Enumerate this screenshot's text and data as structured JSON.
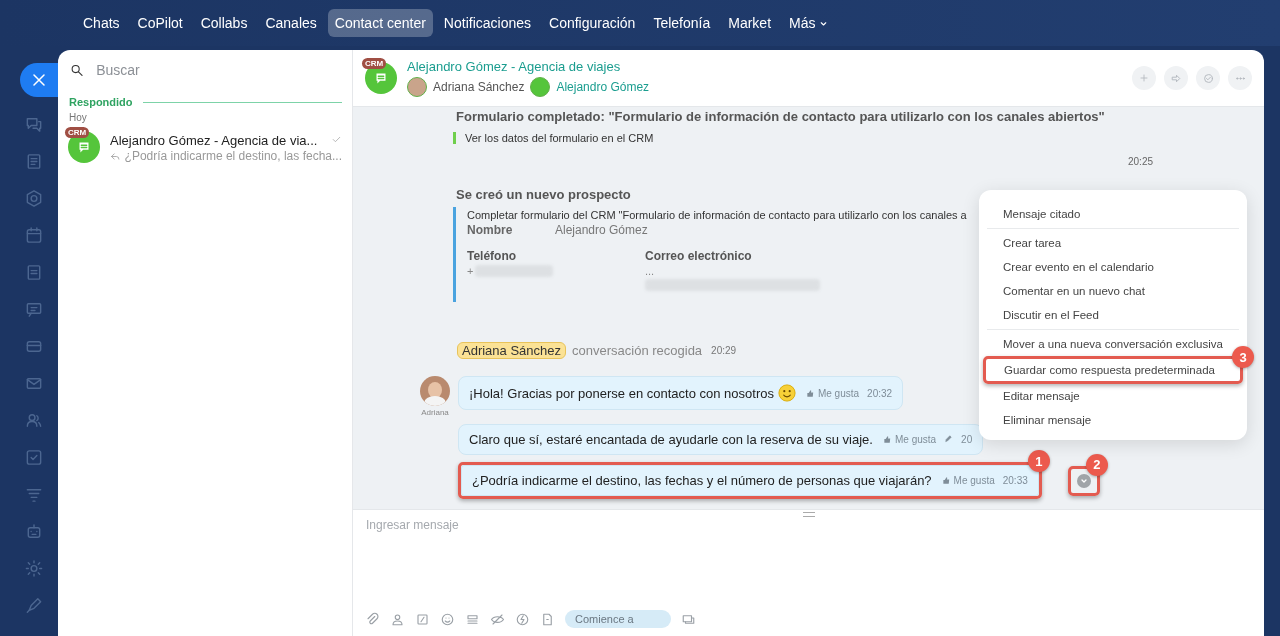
{
  "top_nav": {
    "items": [
      {
        "label": "Chats",
        "selected": false
      },
      {
        "label": "CoPilot",
        "selected": false
      },
      {
        "label": "Collabs",
        "selected": false
      },
      {
        "label": "Canales",
        "selected": false
      },
      {
        "label": "Contact center",
        "selected": true
      },
      {
        "label": "Notificaciones",
        "selected": false
      },
      {
        "label": "Configuración",
        "selected": false
      },
      {
        "label": "Telefonía",
        "selected": false
      },
      {
        "label": "Market",
        "selected": false
      },
      {
        "label": "Más",
        "selected": false,
        "kind": "dropdown"
      }
    ]
  },
  "chat_list": {
    "search": {
      "placeholder": "Buscar"
    },
    "section": "Respondido",
    "date": "Hoy",
    "items": [
      {
        "badge": "CRM",
        "title": "Alejandro Gómez - Agencia de via...",
        "preview": "¿Podría indicarme el destino, las fecha...",
        "read": true
      }
    ]
  },
  "chat": {
    "header": {
      "badge": "CRM",
      "title": "Alejandro Gómez - Agencia de viajes",
      "members": [
        {
          "name": "Adriana Sánchez",
          "kind": "agent"
        },
        {
          "name": "Alejandro Gómez",
          "kind": "client"
        }
      ]
    },
    "timeline": [
      {
        "kind": "form",
        "title": "Formulario completado: \"Formulario de información de contacto para utilizarlo con los canales abiertos\"",
        "link": "Ver los datos del formulario en el CRM",
        "time": "20:25"
      },
      {
        "kind": "lead",
        "title": "Se creó un nuevo prospecto",
        "description": "Completar formulario del CRM \"Formulario de información de contacto para utilizarlo con los canales a",
        "fields": [
          {
            "label": "Nombre",
            "value": "Alejandro Gómez"
          }
        ],
        "contacts": [
          {
            "label": "Teléfono",
            "value": "+"
          },
          {
            "label": "Correo electrónico",
            "value": "..."
          }
        ]
      },
      {
        "kind": "system",
        "name": "Adriana Sánchez",
        "text": "conversación recogida",
        "time": "20:29"
      },
      {
        "kind": "message",
        "author": "Adriana",
        "text": "¡Hola! Gracias por ponerse en contacto con nosotros",
        "emoji": true,
        "like": "Me gusta",
        "time": "20:32",
        "edited": false
      },
      {
        "kind": "message",
        "text": "Claro que sí, estaré encantada de ayudarle con la reserva de su viaje.",
        "emoji": false,
        "like": "Me gusta",
        "time": "20",
        "edited": true
      },
      {
        "kind": "message",
        "text": "¿Podría indicarme el destino, las fechas y el número de personas que viajarán?",
        "emoji": false,
        "like": "Me gusta",
        "time": "20:33",
        "edited": false,
        "callout": "1",
        "menu_callout": "2"
      }
    ],
    "context_menu": {
      "sections": [
        [
          {
            "label": "Mensaje citado"
          }
        ],
        [
          {
            "label": "Crear tarea"
          },
          {
            "label": "Crear evento en el calendario"
          },
          {
            "label": "Comentar en un nuevo chat"
          },
          {
            "label": "Discutir en el Feed"
          }
        ],
        [
          {
            "label": "Mover a una nueva conversación exclusiva"
          },
          {
            "label": "Guardar como respuesta predeterminada",
            "callout": "3"
          },
          {
            "label": "Editar mensaje"
          },
          {
            "label": "Eliminar mensaje"
          }
        ]
      ]
    },
    "composer": {
      "placeholder": "Ingresar mensaje",
      "start_button": "Comience a"
    }
  }
}
